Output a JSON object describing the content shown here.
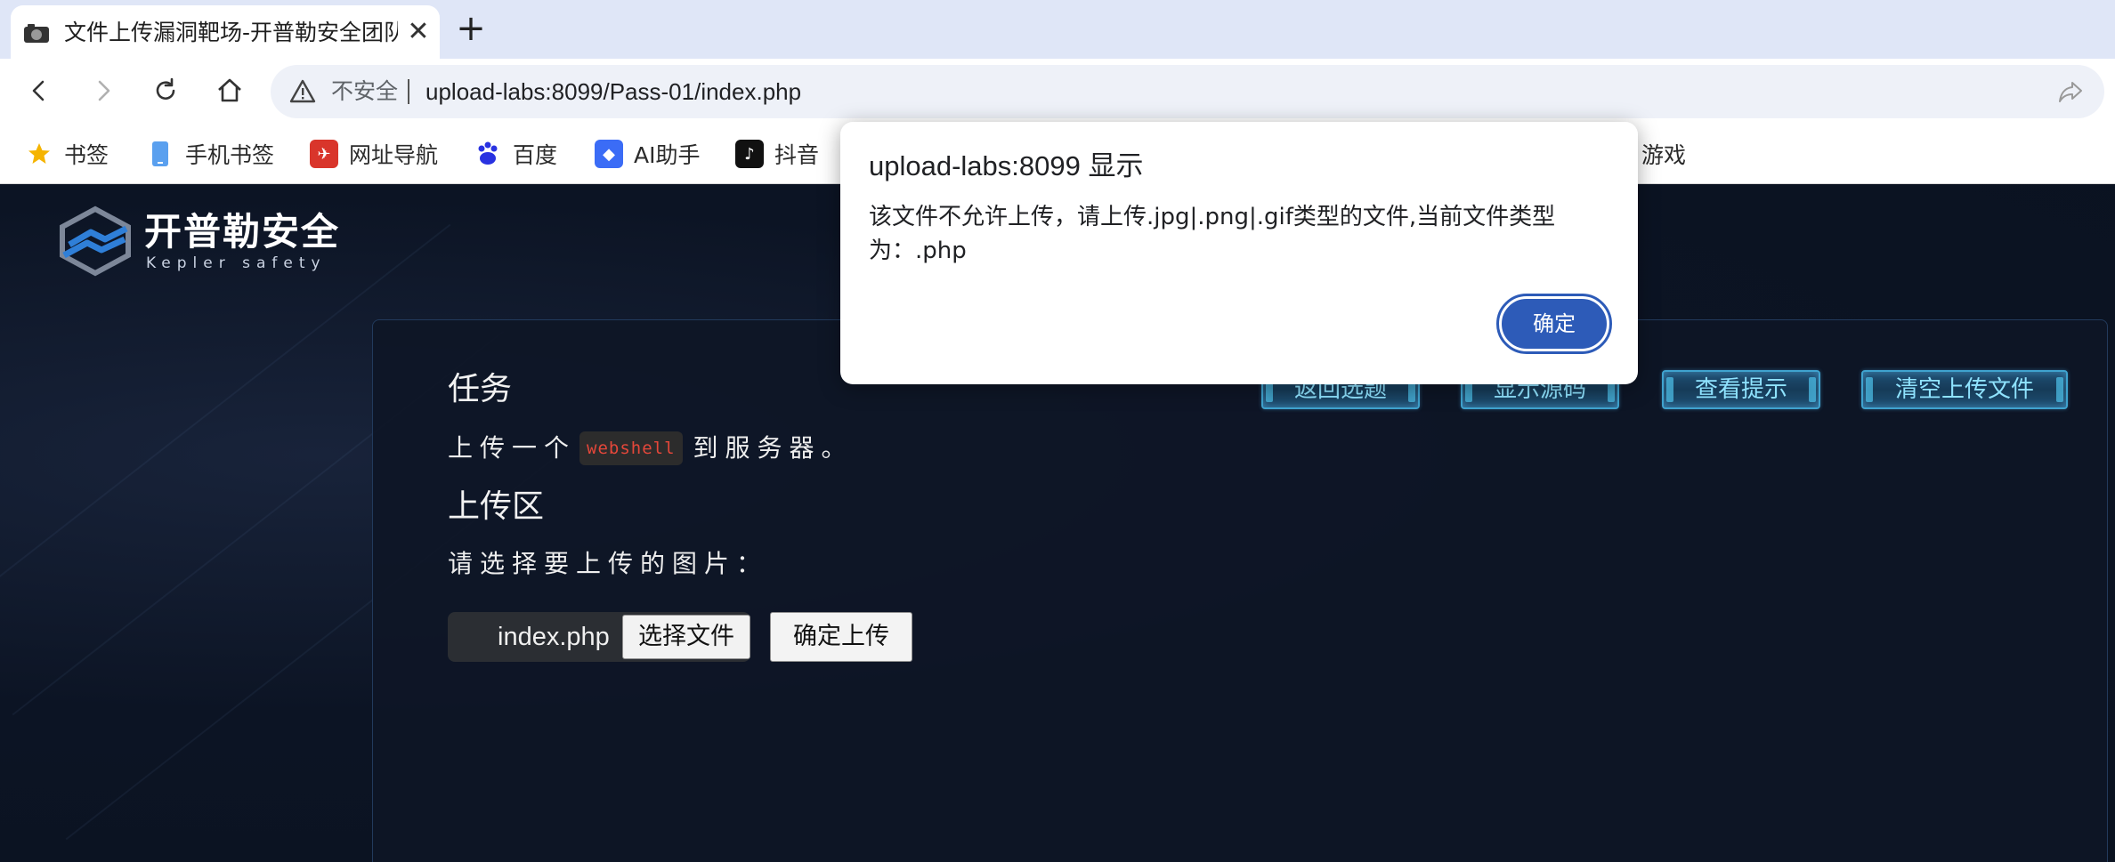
{
  "browser": {
    "tab_title": "文件上传漏洞靶场-开普勒安全团队",
    "tab_close": "✕",
    "new_tab": "+",
    "security_label": "不安全",
    "url": "upload-labs:8099/Pass-01/index.php",
    "bookmarks": [
      {
        "label": "书签",
        "icon": "star-icon",
        "color": "#f5b400"
      },
      {
        "label": "手机书签",
        "icon": "phone-icon",
        "color": "#4a90e2"
      },
      {
        "label": "网址导航",
        "icon": "nav-icon",
        "color": "#d9352b"
      },
      {
        "label": "百度",
        "icon": "baidu-icon",
        "color": "#2932e1"
      },
      {
        "label": "AI助手",
        "icon": "ai-icon",
        "color": "#3b6cf6"
      },
      {
        "label": "抖音",
        "icon": "douyin-icon",
        "color": "#111111"
      },
      {
        "label": "游戏",
        "icon": "game-icon",
        "color": "#999999"
      }
    ]
  },
  "site": {
    "logo_title": "开普勒安全",
    "logo_subtitle": "Kepler safety"
  },
  "panel": {
    "task_heading": "任务",
    "task_prefix": "上传一个",
    "task_code": "webshell",
    "task_suffix": "到服务器。",
    "upload_heading": "上传区",
    "prompt": "请选择要上传的图片：",
    "file_name": "index.php",
    "choose_label": "选择文件",
    "submit_label": "确定上传",
    "buttons": [
      "返回选题",
      "显示源码",
      "查看提示",
      "清空上传文件"
    ]
  },
  "dialog": {
    "title": "upload-labs:8099 显示",
    "message": "该文件不允许上传，请上传.jpg|.png|.gif类型的文件,当前文件类型为：.php",
    "ok_label": "确定"
  }
}
